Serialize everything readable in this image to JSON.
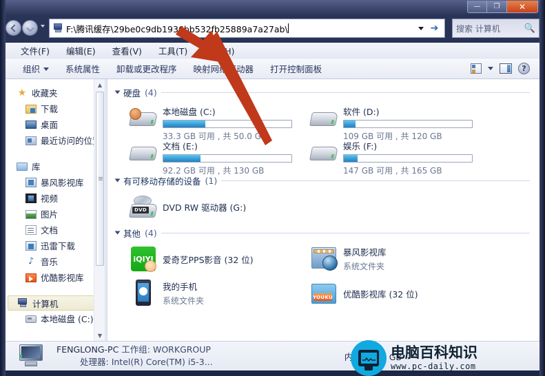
{
  "window": {
    "controls": {
      "minimize": "—",
      "maximize": "❐",
      "close": "✕"
    }
  },
  "address": {
    "icon": "computer-icon",
    "path": "F:\\腾讯缓存\\29be0c9db1936bb532fb25889a7a27ab\\",
    "go_label": "➔",
    "dropdown": "chevron-down-icon"
  },
  "search": {
    "placeholder": "搜索 计算机",
    "icon": "search-icon"
  },
  "menubar": {
    "items": [
      {
        "label": "文件(F)"
      },
      {
        "label": "编辑(E)"
      },
      {
        "label": "查看(V)"
      },
      {
        "label": "工具(T)"
      },
      {
        "label": "帮助(H)"
      }
    ]
  },
  "toolbar": {
    "items": [
      {
        "label": "组织",
        "has_caret": true
      },
      {
        "label": "系统属性",
        "has_caret": false
      },
      {
        "label": "卸载或更改程序",
        "has_caret": false
      },
      {
        "label": "映射网络驱动器",
        "has_caret": false
      },
      {
        "label": "打开控制面板",
        "has_caret": false
      }
    ],
    "right_icons": [
      "view-options-icon",
      "chevron-down-icon",
      "preview-pane-icon",
      "help-icon"
    ],
    "help_glyph": "?"
  },
  "navpane": {
    "groups": [
      {
        "header": {
          "label": "收藏夹",
          "icon": "star-icon"
        },
        "items": [
          {
            "label": "下载",
            "icon": "downloads-icon"
          },
          {
            "label": "桌面",
            "icon": "desktop-icon"
          },
          {
            "label": "最近访问的位置",
            "icon": "recent-places-icon"
          }
        ]
      },
      {
        "header": {
          "label": "库",
          "icon": "library-icon"
        },
        "items": [
          {
            "label": "暴风影视库",
            "icon": "baofeng-library-icon"
          },
          {
            "label": "视频",
            "icon": "videos-icon"
          },
          {
            "label": "图片",
            "icon": "pictures-icon"
          },
          {
            "label": "文档",
            "icon": "documents-icon"
          },
          {
            "label": "迅雷下载",
            "icon": "xunlei-icon"
          },
          {
            "label": "音乐",
            "icon": "music-icon"
          },
          {
            "label": "优酷影视库",
            "icon": "youku-library-icon"
          }
        ]
      },
      {
        "header": {
          "label": "计算机",
          "icon": "computer-icon",
          "selected": true
        },
        "items": [
          {
            "label": "本地磁盘 (C:)",
            "icon": "local-disk-icon"
          }
        ]
      }
    ],
    "scrollbar": {
      "up": "▲",
      "down": "▼"
    }
  },
  "content": {
    "sections": [
      {
        "title": "硬盘",
        "count": "(4)",
        "kind": "drives",
        "items": [
          {
            "name": "本地磁盘 (C:)",
            "info": "33.3 GB 可用 , 共 50.0 GB",
            "used_percent": 33,
            "icon": "system-drive-icon"
          },
          {
            "name": "软件 (D:)",
            "info": "109 GB 可用 , 共 120 GB",
            "used_percent": 9,
            "icon": "drive-icon"
          },
          {
            "name": "文档 (E:)",
            "info": "92.2 GB 可用 , 共 130 GB",
            "used_percent": 29,
            "icon": "drive-icon"
          },
          {
            "name": "娱乐 (F:)",
            "info": "147 GB 可用 , 共 165 GB",
            "used_percent": 11,
            "icon": "drive-icon"
          }
        ]
      },
      {
        "title": "有可移动存储的设备",
        "count": "(1)",
        "kind": "removable",
        "items": [
          {
            "name": "DVD RW 驱动器 (G:)",
            "info": "",
            "icon": "dvd-drive-icon",
            "badge": "DVD"
          }
        ]
      },
      {
        "title": "其他",
        "count": "(4)",
        "kind": "other",
        "items": [
          {
            "name": "爱奇艺PPS影音 (32 位)",
            "info": "",
            "icon": "iqiyi-icon",
            "glyph": "iQIYI"
          },
          {
            "name": "暴风影视库",
            "info": "系统文件夹",
            "icon": "baofeng-folder-icon"
          },
          {
            "name": "我的手机",
            "info": "系统文件夹",
            "icon": "my-phone-icon"
          },
          {
            "name": "优酷影视库 (32 位)",
            "info": "",
            "icon": "youku-folder-icon",
            "glyph": "YOUKU"
          }
        ]
      }
    ]
  },
  "statusbar": {
    "computer_name": "FENGLONG-PC",
    "workgroup_label": "工作组:",
    "workgroup_value": "WORKGROUP",
    "processor_label": "处理器:",
    "processor_value": "Intel(R) Core(TM) i5-3...",
    "memory_label": "内存:",
    "memory_value": "4.00 GB"
  },
  "watermark": {
    "title": "电脑百科知识",
    "url": "www.pc-daily.com"
  },
  "colors": {
    "accent": "#2c7fc0",
    "title_close": "#c8411a",
    "arrow": "#c0391a",
    "watermark_blue": "#12a8e0",
    "selection": "#eeead3"
  }
}
